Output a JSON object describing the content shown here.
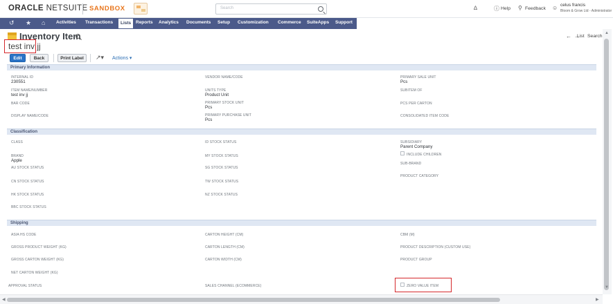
{
  "header": {
    "brand_bold": "ORACLE",
    "brand_light": " NETSUITE",
    "environment": "SANDBOX",
    "search_placeholder": "Search",
    "help": "Help",
    "feedback": "Feedback",
    "user_name": "celus francis",
    "user_role": "Bloom & Grow Ltd - Administrator"
  },
  "nav": {
    "items": [
      "Activities",
      "Transactions",
      "Lists",
      "Reports",
      "Analytics",
      "Documents",
      "Setup",
      "Customization",
      "Commerce",
      "SuiteApps",
      "Support"
    ],
    "active": "Lists"
  },
  "page": {
    "title": "Inventory Item",
    "record_name": "test inv jj",
    "list_link": "List",
    "search_link": "Search"
  },
  "buttons": {
    "edit": "Edit",
    "back": "Back",
    "print_label": "Print Label",
    "actions": "Actions ▾"
  },
  "sections": {
    "primary": "Primary Information",
    "classification": "Classification",
    "shipping": "Shipping"
  },
  "primary": {
    "internal_id_label": "INTERNAL ID",
    "internal_id_value": "230551",
    "item_name_label": "ITEM NAME/NUMBER",
    "item_name_value": "test inv jj",
    "bar_code_label": "BAR CODE",
    "display_name_label": "DISPLAY NAME/CODE",
    "vendor_name_label": "VENDOR NAME/CODE",
    "units_type_label": "UNITS TYPE",
    "units_type_value": "Product Unit",
    "primary_stock_label": "PRIMARY STOCK UNIT",
    "primary_stock_value": "Pcs",
    "primary_purchase_label": "PRIMARY PURCHASE UNIT",
    "primary_purchase_value": "Pcs",
    "primary_sale_label": "PRIMARY SALE UNIT",
    "primary_sale_value": "Pcs",
    "subitem_label": "SUBITEM OF",
    "pcs_carton_label": "PCS PER CARTON",
    "consolidated_label": "CONSOLIDATED ITEM CODE"
  },
  "classification": {
    "class_label": "CLASS",
    "brand_label": "BRAND",
    "brand_value": "Apple",
    "au_label": "AU STOCK STATUS",
    "cn_label": "CN STOCK STATUS",
    "hk_label": "HK STOCK STATUS",
    "bbc_label": "BBC STOCK STATUS",
    "id_label": "ID STOCK STATUS",
    "my_label": "MY STOCK STATUS",
    "sg_label": "SG STOCK STATUS",
    "tw_label": "TW STOCK STATUS",
    "nz_label": "NZ STOCK STATUS",
    "subsidiary_label": "SUBSIDIARY",
    "subsidiary_value": "Parent Company",
    "include_children_label": "INCLUDE CHILDREN",
    "sub_brand_label": "SUB-BRAND",
    "product_category_label": "PRODUCT CATEGORY"
  },
  "shipping": {
    "asia_hs_label": "ASIA HS CODE",
    "gross_product_label": "GROSS PRODUCT WEIGHT (KG)",
    "gross_carton_label": "GROSS CARTON WEIGHT (KG)",
    "net_carton_label": "NET CARTON WEIGHT (KG)",
    "approval_label": "APPROVAL STATUS",
    "carton_height_label": "CARTON HEIGHT (CM)",
    "carton_length_label": "CARTON LENGTH (CM)",
    "carton_width_label": "CARTON WIDTH (CM)",
    "sales_channel_label": "SALES CHANNEL (ECOMMERCE)",
    "cbm_label": "CBM (M)",
    "product_desc_label": "PRODUCT DESCRIPTION (CUSTOM USE)",
    "product_group_label": "PRODUCT GROUP",
    "zero_value_label": "ZERO VALUE ITEM"
  },
  "icons": {
    "recent": "history-icon",
    "favorite": "star-icon",
    "home": "home-icon",
    "share": "share-icon",
    "notifications": "bell-icon",
    "help": "help-icon",
    "feedback": "chat-icon",
    "user": "user-icon"
  },
  "colors": {
    "nav_bg": "#4b5a8a",
    "section_bg": "#dfe7f3",
    "edit_button": "#2a73c7",
    "sandbox": "#e8761d",
    "highlight": "#d4262a"
  }
}
